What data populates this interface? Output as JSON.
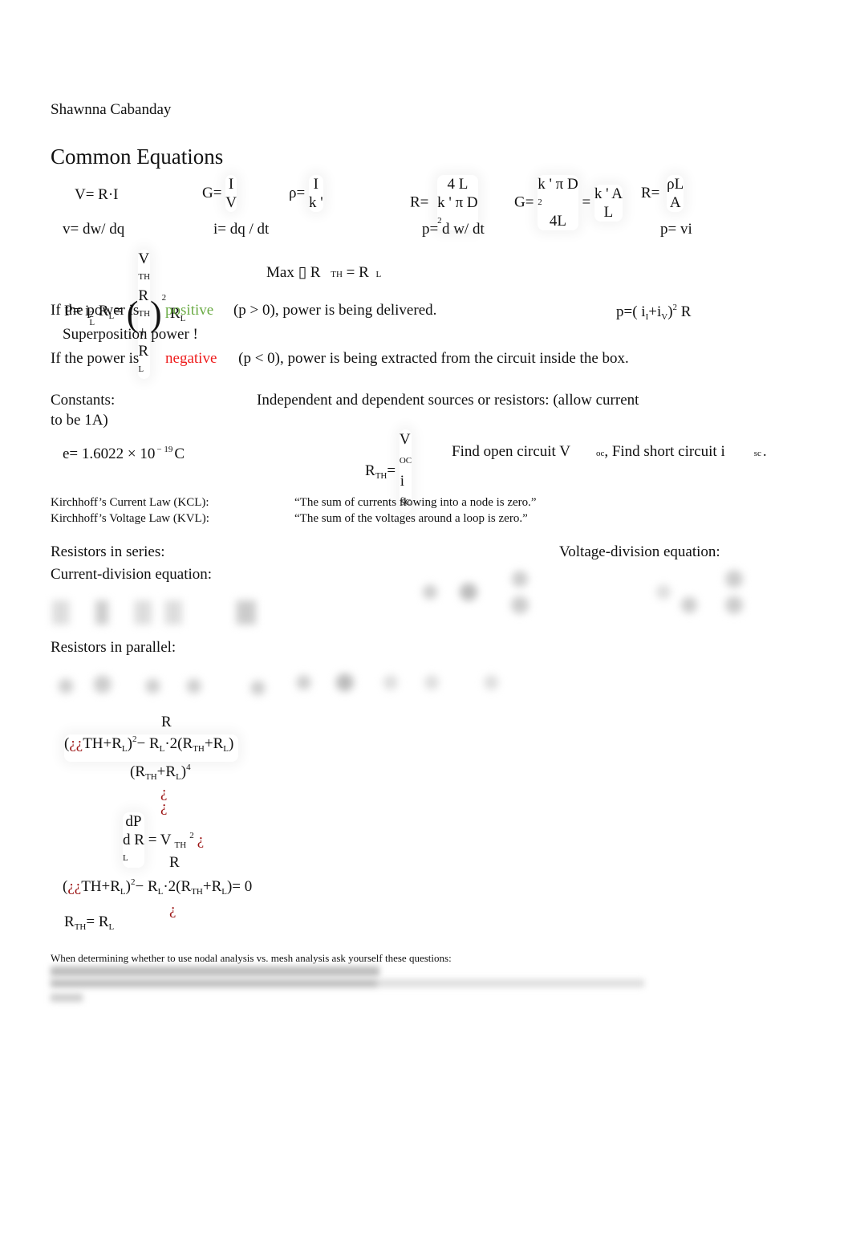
{
  "author": "Shawnna Cabanday",
  "title": "Common Equations",
  "equations_row1": {
    "ohm": "V= R·I",
    "conductance": {
      "lhs": "G=",
      "num": "I",
      "den": "V"
    },
    "resistivity": {
      "lhs": "ρ=",
      "num": "I",
      "den": "k '"
    },
    "resistance_wire": {
      "lhs": "R=",
      "num": "4 L",
      "den": "k ' π D",
      "den_sup": "2"
    },
    "conductance_wire": {
      "lhs": "G=",
      "num": "k ' π D",
      "num_sup": "2",
      "den": "4L",
      "eq": "=",
      "num2": "k ' A",
      "den2": "L"
    },
    "resistance_area": {
      "lhs": "R=",
      "num": "ρL",
      "den": "A"
    }
  },
  "equations_row2": {
    "voltage": "v= dw/ dq",
    "current": "i= dq / dt",
    "power_deriv": "p= d w/ dt",
    "power": "p= vi"
  },
  "max_power": {
    "lhs": "P= i",
    "lhs_sub": "L",
    "lhs_sup": "2",
    "r": "R",
    "r_sub": "L",
    "eq": "=",
    "num": "V",
    "num_sub": "TH",
    "den_a": "R",
    "den_a_sub": "TH",
    "plus": "+",
    "den_b": "R",
    "den_b_sub": "L",
    "exp": "2",
    "tail": "R",
    "tail_sub": "L",
    "max_text": "Max ▯ R",
    "max_sub1": "TH",
    "max_eq": "= R",
    "max_sub2": "L"
  },
  "power_sign": {
    "positive": {
      "prefix": "If the power is",
      "word": "positive",
      "suffix": "(p > 0), power is being delivered."
    },
    "negative": {
      "prefix": "If the power is",
      "word": "negative",
      "suffix": "(p < 0), power is being extracted from the circuit inside the box."
    },
    "superposition_label": "Superposition power !",
    "superposition_eq": {
      "lhs": "p=( i",
      "s1": "I",
      "plus": "+i",
      "s2": "V",
      "close": ")",
      "exp": "2",
      "tail": " R"
    }
  },
  "constants": {
    "label": "Constants:",
    "sources_text": "Independent and dependent sources or resistors: (allow current",
    "sources_cont": "to be 1A)",
    "electron": {
      "base": "e= 1.6022 × 10",
      "exp": "− 19",
      "unit": "C"
    },
    "thevenin": {
      "lhs": "R",
      "lhs_sub": "TH",
      "eq": "=",
      "num": "V",
      "num_sub": "OC",
      "den": "i",
      "den_sub": "SC"
    },
    "find_text": {
      "a": "Find open circuit V",
      "a_sub": "oc",
      "b": ", Find short circuit i",
      "b_sub": "sc",
      "end": "."
    }
  },
  "kirchhoff": [
    {
      "law": "Kirchhoff’s Current Law (KCL):",
      "statement": "“The sum of currents flowing into a node is zero.”"
    },
    {
      "law": "Kirchhoff’s Voltage Law (KVL):",
      "statement": "“The sum of the voltages around a loop is zero.”"
    }
  ],
  "sections": {
    "series": "Resistors in series:",
    "voltage_division": "Voltage-division equation:",
    "current_division": "Current-division equation:",
    "parallel": "Resistors in parallel:"
  },
  "derivation": {
    "r_top": "R",
    "line1": {
      "open": "(",
      "q": "¿¿",
      "a": "TH+R",
      "a_sub": "L",
      "close": ")",
      "exp": "2",
      "minus": "− R",
      "b_sub": "L",
      "rest": "·2(R",
      "c_sub": "TH",
      "plus": "+R",
      "d_sub": "L",
      "end": ")"
    },
    "denom": {
      "a": "(R",
      "a_sub": "TH",
      "plus": "+R",
      "b_sub": "L",
      "close": ")",
      "exp": "4"
    },
    "q1": "¿",
    "q2": "¿",
    "dpdr": {
      "num": "dP",
      "den": "d R",
      "den_sub": "L",
      "eq": "= V",
      "sub": "TH",
      "exp": "2",
      "q": "¿"
    },
    "r_top2": "R",
    "line2": {
      "open": "(",
      "q": "¿¿",
      "a": "TH+R",
      "a_sub": "L",
      "close": ")",
      "exp": "2",
      "minus": "− R",
      "b_sub": "L",
      "rest": "·2(R",
      "c_sub": "TH",
      "plus": "+R",
      "d_sub": "L",
      "end": ")= 0"
    },
    "q3": "¿",
    "result": {
      "a": "R",
      "a_sub": "TH",
      "eq": "= R",
      "b_sub": "L"
    }
  },
  "nodal_mesh": "When determining whether to use nodal analysis vs. mesh analysis ask yourself these questions:",
  "blurred_placeholder": "██████████████████████████████████████"
}
